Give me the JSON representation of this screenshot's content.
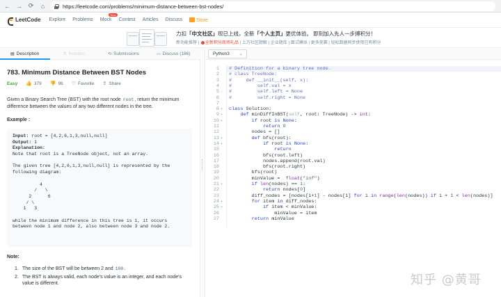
{
  "browser": {
    "url": "https://leetcode.com/problems/minimum-distance-between-bst-nodes/",
    "back": "←",
    "forward": "→",
    "reload": "⟳",
    "home": "⌂"
  },
  "nav": {
    "logo": "LeetCode",
    "items": [
      "Explore",
      "Problems",
      "Mock",
      "Contest",
      "Articles",
      "Discuss"
    ],
    "mock_badge": "New",
    "store": "Store"
  },
  "banner": {
    "line1_parts": [
      "力扣",
      "「中文社区」",
      "现已上线，全新",
      "「个人主页」",
      "更优体验。 即刻加入先人一步搏积分！"
    ],
    "line2": [
      "新功能推荐",
      "全新积分商场礼品",
      "上万社区题解",
      "企业题库",
      "面试模拟",
      "更多竞赛",
      "轻松数据同步使用已有积分"
    ]
  },
  "tabs": {
    "description": "Description",
    "solution": "Solution",
    "submissions": "Submissions",
    "discuss": "Discuss (186)"
  },
  "problem": {
    "title": "783. Minimum Distance Between BST Nodes",
    "difficulty": "Easy",
    "likes": "379",
    "dislikes": "98",
    "favorite": "Favorite",
    "share": "Share",
    "desc_before": "Given a Binary Search Tree (BST) with the root node ",
    "desc_code": "root",
    "desc_after": ", return the minimum difference between the values of any two different nodes in the tree.",
    "example_label": "Example :",
    "example_lines": [
      {
        "k": "Input:",
        "v": " root = [4,2,6,1,3,null,null]"
      },
      {
        "k": "Output:",
        "v": " 1"
      },
      {
        "k": "Explanation:",
        "v": ""
      },
      {
        "k": "",
        "v": "Note that root is a TreeNode object, not an array."
      },
      {
        "k": "",
        "v": ""
      },
      {
        "k": "",
        "v": "The given tree [4,2,6,1,3,null,null] is represented by the"
      },
      {
        "k": "",
        "v": "following diagram:"
      },
      {
        "k": "",
        "v": ""
      },
      {
        "k": "",
        "v": "          4"
      },
      {
        "k": "",
        "v": "        /   \\"
      },
      {
        "k": "",
        "v": "      2      6"
      },
      {
        "k": "",
        "v": "     / \\"
      },
      {
        "k": "",
        "v": "    1   3"
      },
      {
        "k": "",
        "v": ""
      },
      {
        "k": "",
        "v": "while the minimum difference in this tree is 1, it occurs"
      },
      {
        "k": "",
        "v": "between node 1 and node 2, also between node 3 and node 2."
      }
    ],
    "note_label": "Note:",
    "notes": [
      {
        "num": "1.",
        "before": "The size of the BST will be between 2 and ",
        "code": "100",
        "after": "."
      },
      {
        "num": "2.",
        "before": "The BST is always valid, each node's value is an integer, and each node's value is different.",
        "code": "",
        "after": ""
      }
    ]
  },
  "editor": {
    "language": "Python3",
    "code_lines": [
      {
        "n": "1",
        "fold": "",
        "html": "<span class='c-comment'># Definition for a binary tree node.</span>",
        "hl": true
      },
      {
        "n": "2",
        "fold": "",
        "html": "<span class='c-comment'># class TreeNode:</span>"
      },
      {
        "n": "3",
        "fold": "",
        "html": "<span class='c-comment'>#     def __init__(self, x):</span>"
      },
      {
        "n": "4",
        "fold": "",
        "html": "<span class='c-comment'>#         self.val = x</span>"
      },
      {
        "n": "5",
        "fold": "",
        "html": "<span class='c-comment'>#         self.left = None</span>"
      },
      {
        "n": "6",
        "fold": "",
        "html": "<span class='c-comment'>#         self.right = None</span>"
      },
      {
        "n": "7",
        "fold": "",
        "html": ""
      },
      {
        "n": "8",
        "fold": "▾",
        "html": "<span class='c-kw'>class</span> Solution:"
      },
      {
        "n": "9",
        "fold": "▾",
        "html": "    <span class='c-kw'>def</span> minDiffInBST(<span class='c-self'>self</span>, root: TreeNode) -> <span class='c-builtin'>int</span>:"
      },
      {
        "n": "10",
        "fold": "▾",
        "html": "        <span class='c-kw'>if</span> root <span class='c-kw'>is</span> <span class='c-kw'>None</span>:"
      },
      {
        "n": "11",
        "fold": "",
        "html": "            <span class='c-kw'>return</span> <span class='c-num'>0</span>"
      },
      {
        "n": "12",
        "fold": "",
        "html": "        nodes = []"
      },
      {
        "n": "13",
        "fold": "▾",
        "html": "        <span class='c-kw'>def</span> bfs(root):"
      },
      {
        "n": "14",
        "fold": "▾",
        "html": "            <span class='c-kw'>if</span> root <span class='c-kw'>is</span> <span class='c-kw'>None</span>:"
      },
      {
        "n": "15",
        "fold": "",
        "html": "                <span class='c-kw'>return</span>"
      },
      {
        "n": "16",
        "fold": "",
        "html": "            bfs(root.left)"
      },
      {
        "n": "17",
        "fold": "",
        "html": "            nodes.append(root.val)"
      },
      {
        "n": "18",
        "fold": "",
        "html": "            bfs(root.right)"
      },
      {
        "n": "19",
        "fold": "",
        "html": "        bfs(root)"
      },
      {
        "n": "20",
        "fold": "",
        "html": "        minValue =  <span class='c-builtin'>float</span>(<span class='c-str'>\"inf\"</span>)"
      },
      {
        "n": "21",
        "fold": "▾",
        "html": "        <span class='c-kw'>if</span> <span class='c-builtin'>len</span>(nodes) == <span class='c-num'>1</span>:"
      },
      {
        "n": "22",
        "fold": "",
        "html": "            <span class='c-kw'>return</span> nodes[<span class='c-num'>0</span>]"
      },
      {
        "n": "23",
        "fold": "",
        "html": "        diff_nodes = [nodes[i+<span class='c-num'>1</span>] - nodes[i] <span class='c-kw'>for</span> i <span class='c-kw'>in</span> <span class='c-builtin'>range</span>(<span class='c-builtin'>len</span>(nodes)) <span class='c-kw'>if</span> i + <span class='c-num'>1</span> < <span class='c-builtin'>len</span>(nodes)]"
      },
      {
        "n": "24",
        "fold": "▾",
        "html": "        <span class='c-kw'>for</span> item <span class='c-kw'>in</span> diff_nodes:"
      },
      {
        "n": "25",
        "fold": "▾",
        "html": "            <span class='c-kw'>if</span> item < minValue:"
      },
      {
        "n": "26",
        "fold": "",
        "html": "                minValue = item"
      },
      {
        "n": "27",
        "fold": "",
        "html": "        <span class='c-kw'>return</span> minValue"
      }
    ]
  },
  "watermark": "知乎 @黄哥"
}
